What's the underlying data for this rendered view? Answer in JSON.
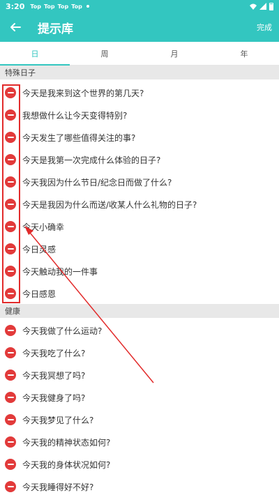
{
  "status_bar": {
    "time": "3:20",
    "notifications": [
      "Top",
      "Top",
      "Top",
      "Top"
    ]
  },
  "header": {
    "title": "提示库",
    "done_label": "完成"
  },
  "tabs": [
    {
      "label": "日",
      "active": true
    },
    {
      "label": "周",
      "active": false
    },
    {
      "label": "月",
      "active": false
    },
    {
      "label": "年",
      "active": false
    }
  ],
  "sections": [
    {
      "title": "特殊日子",
      "items": [
        "今天是我来到这个世界的第几天?",
        "我想做什么让今天变得特别?",
        "今天发生了哪些值得关注的事?",
        "今天是我第一次完成什么体验的日子?",
        "今天我因为什么节日/纪念日而做了什么?",
        "今天是我因为什么而送/收某人什么礼物的日子?",
        "今天小确幸",
        "今日灵感",
        "今天触动我的一件事",
        "今日感恩"
      ]
    },
    {
      "title": "健康",
      "items": [
        "今天我做了什么运动?",
        "今天我吃了什么?",
        "今天我冥想了吗?",
        "今天我健身了吗?",
        "今天我梦见了什么?",
        "今天我的精神状态如何?",
        "今天我的身体状况如何?",
        "今天我睡得好不好?"
      ]
    }
  ],
  "colors": {
    "accent": "#33c6c0",
    "delete": "#e23a3a",
    "annotation": "#e22b2b",
    "section_bg": "#e8e8e8"
  },
  "icons": {
    "back": "arrow-left-icon",
    "delete": "minus-circle-icon"
  }
}
